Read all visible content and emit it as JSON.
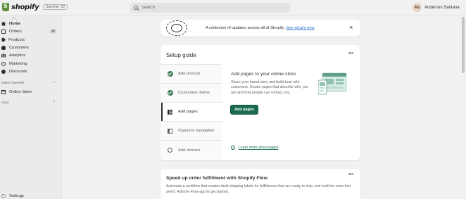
{
  "brand": {
    "name": "shopify",
    "edition": "Summer '22",
    "logo_color": "#5e8e3e"
  },
  "search": {
    "placeholder": "Search"
  },
  "user": {
    "initials": "AS",
    "name": "Anderson Santana"
  },
  "sidebar": {
    "items": [
      {
        "label": "Home",
        "icon": "home-icon",
        "active": true
      },
      {
        "label": "Orders",
        "icon": "orders-icon",
        "badge": "28"
      },
      {
        "label": "Products",
        "icon": "products-icon"
      },
      {
        "label": "Customers",
        "icon": "customers-icon"
      },
      {
        "label": "Analytics",
        "icon": "analytics-icon"
      },
      {
        "label": "Marketing",
        "icon": "marketing-icon"
      },
      {
        "label": "Discounts",
        "icon": "discounts-icon"
      }
    ],
    "sales_channels_label": "Sales channels",
    "online_store_label": "Online Store",
    "apps_label": "Apps",
    "settings_label": "Settings"
  },
  "banner": {
    "text": "A collection of updates across all of Shopify.",
    "link": "See what's new",
    "close": "×"
  },
  "setup_guide": {
    "title": "Setup guide",
    "more": "•••",
    "steps": [
      {
        "label": "Add product",
        "completed": true
      },
      {
        "label": "Customize theme",
        "completed": true
      },
      {
        "label": "Add pages",
        "active": true
      },
      {
        "label": "Organize navigation"
      },
      {
        "label": "Add domain"
      }
    ],
    "detail": {
      "title": "Add pages to your online store",
      "description": "Share your brand story and build trust with customers. Create pages that describe who you are and how people can contact you.",
      "button": "Add pages",
      "learn_more": "Learn more about pages"
    }
  },
  "flow_card": {
    "title": "Speed up order fulfillment with Shopify Flow",
    "more": "•••",
    "description": "Automate a workflow that creates draft shipping labels for fulfillments that are ready to ship, and hold the ones that aren't. Add the Flow app to get started."
  },
  "colors": {
    "primary": "#1a6b4f",
    "check": "#3b7a57",
    "link": "#2c6ecb",
    "background": "#f1f1f1"
  }
}
